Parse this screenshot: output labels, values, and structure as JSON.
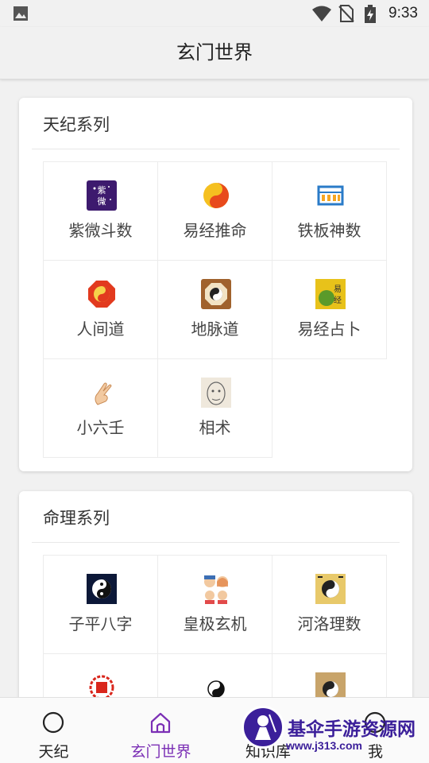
{
  "status_bar": {
    "time": "9:33"
  },
  "app": {
    "title": "玄门世界"
  },
  "sections": [
    {
      "title": "天纪系列",
      "items": [
        {
          "label": "紫微斗数",
          "icon": "ziwei-icon"
        },
        {
          "label": "易经推命",
          "icon": "yinyang-orange-icon"
        },
        {
          "label": "铁板神数",
          "icon": "abacus-icon"
        },
        {
          "label": "人间道",
          "icon": "bagua-red-icon"
        },
        {
          "label": "地脉道",
          "icon": "bagua-brown-icon"
        },
        {
          "label": "易经占卜",
          "icon": "yijing-book-icon"
        },
        {
          "label": "小六壬",
          "icon": "hand-icon"
        },
        {
          "label": "相术",
          "icon": "face-sketch-icon"
        }
      ]
    },
    {
      "title": "命理系列",
      "items": [
        {
          "label": "子平八字",
          "icon": "yinyang-night-icon"
        },
        {
          "label": "皇极玄机",
          "icon": "family-icon"
        },
        {
          "label": "河洛理数",
          "icon": "bagua-scroll-icon"
        },
        {
          "label": "",
          "icon": "red-seal-icon"
        },
        {
          "label": "",
          "icon": "yinyang-small-icon"
        },
        {
          "label": "",
          "icon": "bagua-brown-icon"
        }
      ]
    }
  ],
  "tabs": [
    {
      "label": "天纪",
      "icon": "circle-icon",
      "active": false
    },
    {
      "label": "玄门世界",
      "icon": "home-icon",
      "active": true
    },
    {
      "label": "知识库",
      "icon": "book-icon",
      "active": false
    },
    {
      "label": "我",
      "icon": "profile-icon",
      "active": false
    }
  ],
  "watermark": {
    "text": "基伞手游资源网",
    "url": "www.j313.com"
  },
  "colors": {
    "accent": "#7b2fb5",
    "background": "#f1f1f1"
  }
}
